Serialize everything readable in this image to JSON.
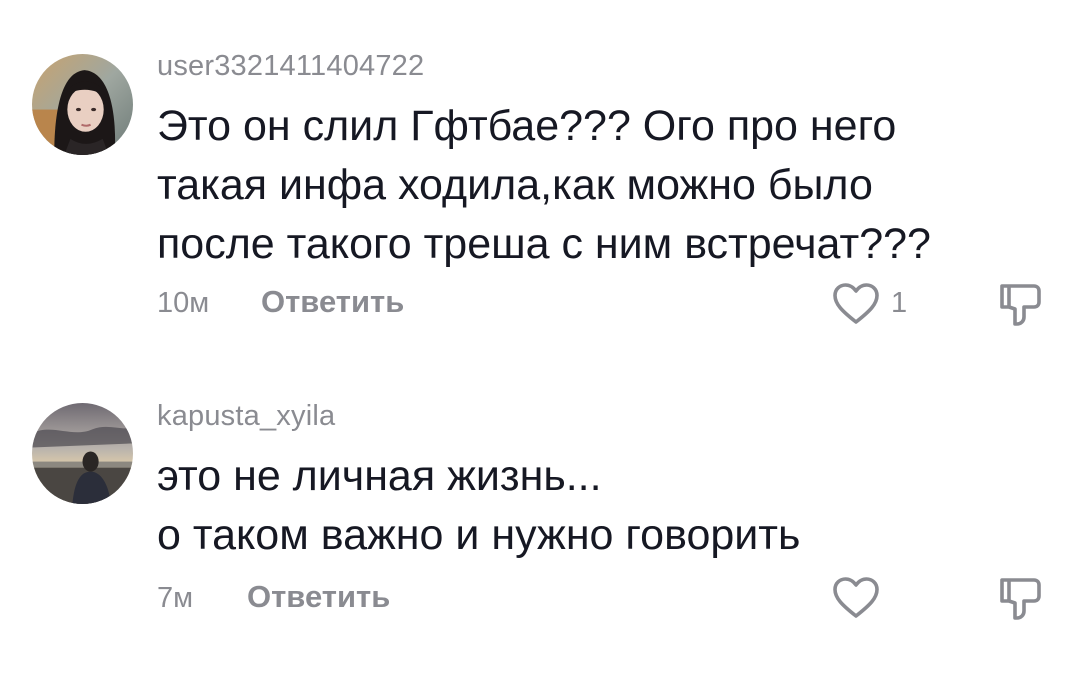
{
  "comments": [
    {
      "username": "user3321411404722",
      "text_lines": [
        "Это он слил Гфтбае??? Ого про него",
        "такая инфа ходила,как можно было",
        "после такого треша с ним встречат???"
      ],
      "time": "10м",
      "reply_label": "Ответить",
      "like_count": "1",
      "avatar_icon": "user-avatar-photo"
    },
    {
      "username": "kapusta_xyila",
      "text_lines": [
        "это не личная жизнь...",
        "о таком важно и нужно говорить"
      ],
      "time": "7м",
      "reply_label": "Ответить",
      "like_count": "",
      "avatar_icon": "user-avatar-photo"
    }
  ],
  "icons": {
    "like": "heart-outline-icon",
    "dislike": "thumbs-down-outline-icon"
  },
  "colors": {
    "primary_text": "#161823",
    "secondary_text": "#8a8b91",
    "icon_stroke": "#8a8b91"
  }
}
